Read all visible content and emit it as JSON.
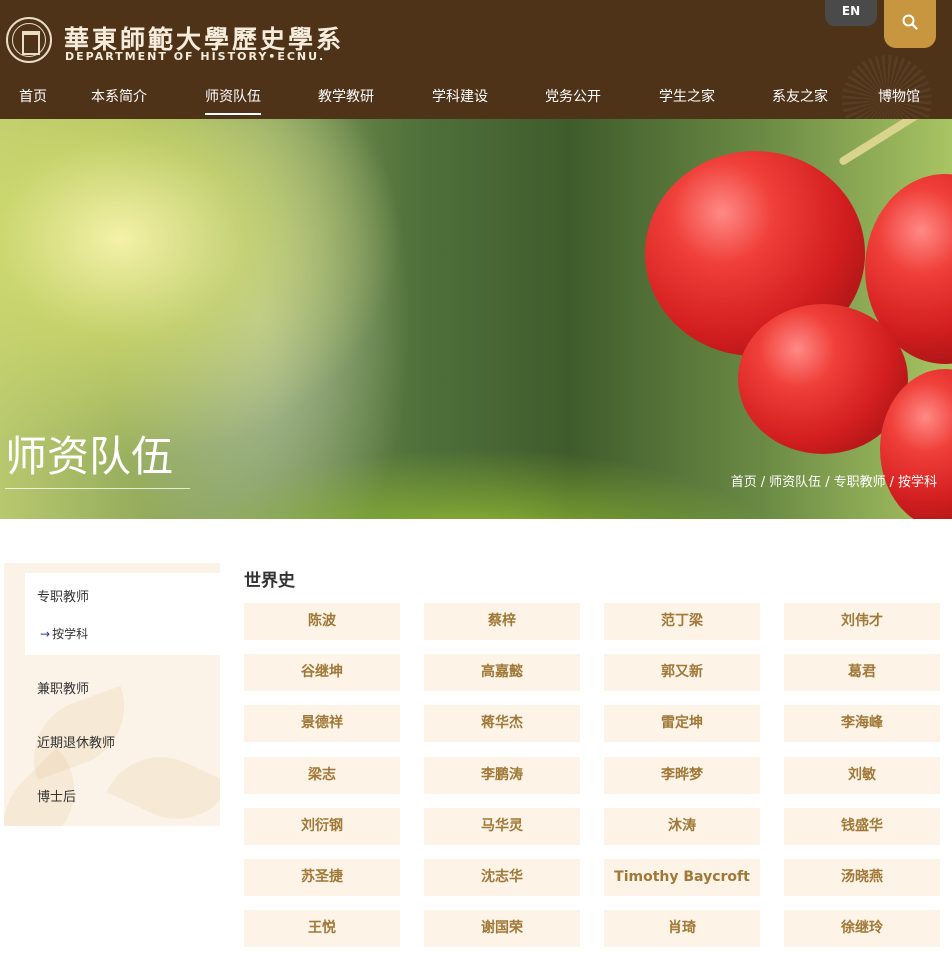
{
  "header": {
    "logo_cn": "華東師範大學歷史學系",
    "logo_en": "DEPARTMENT OF HISTORY•ECNU.",
    "lang_label": "EN",
    "nav": [
      "首页",
      "本系简介",
      "师资队伍",
      "教学教研",
      "学科建设",
      "党务公开",
      "学生之家",
      "系友之家",
      "博物馆"
    ],
    "active_nav": "师资队伍"
  },
  "banner": {
    "title": "师资队伍",
    "breadcrumb": [
      "首页",
      "师资队伍",
      "专职教师",
      "按学科"
    ],
    "separator": "/"
  },
  "sidebar": {
    "items": [
      "专职教师",
      "兼职教师",
      "近期退休教师",
      "博士后"
    ],
    "active_item": "专职教师",
    "sub_arrow": "→",
    "sub_item": "按学科"
  },
  "main": {
    "section_title": "世界史",
    "faculty": [
      "陈波",
      "蔡梓",
      "范丁梁",
      "刘伟才",
      "谷继坤",
      "高嘉懿",
      "郭又新",
      "葛君",
      "景德祥",
      "蒋华杰",
      "雷定坤",
      "李海峰",
      "梁志",
      "李鹏涛",
      "李晔梦",
      "刘敏",
      "刘衍钢",
      "马华灵",
      "沐涛",
      "钱盛华",
      "苏圣捷",
      "沈志华",
      "Timothy Baycroft",
      "汤晓燕",
      "王悦",
      "谢国荣",
      "肖琦",
      "徐继玲"
    ]
  },
  "colors": {
    "header_bg": "#4f3318",
    "search_bg": "#c8963e",
    "lang_bg": "#4a4a4a",
    "cell_bg": "#fdf3e6",
    "cell_text": "#a07838",
    "sidebar_bg": "#fbf3e8"
  },
  "icons": {
    "logo": "university-emblem-icon",
    "search": "search-icon",
    "arrow": "right-arrow-icon"
  }
}
